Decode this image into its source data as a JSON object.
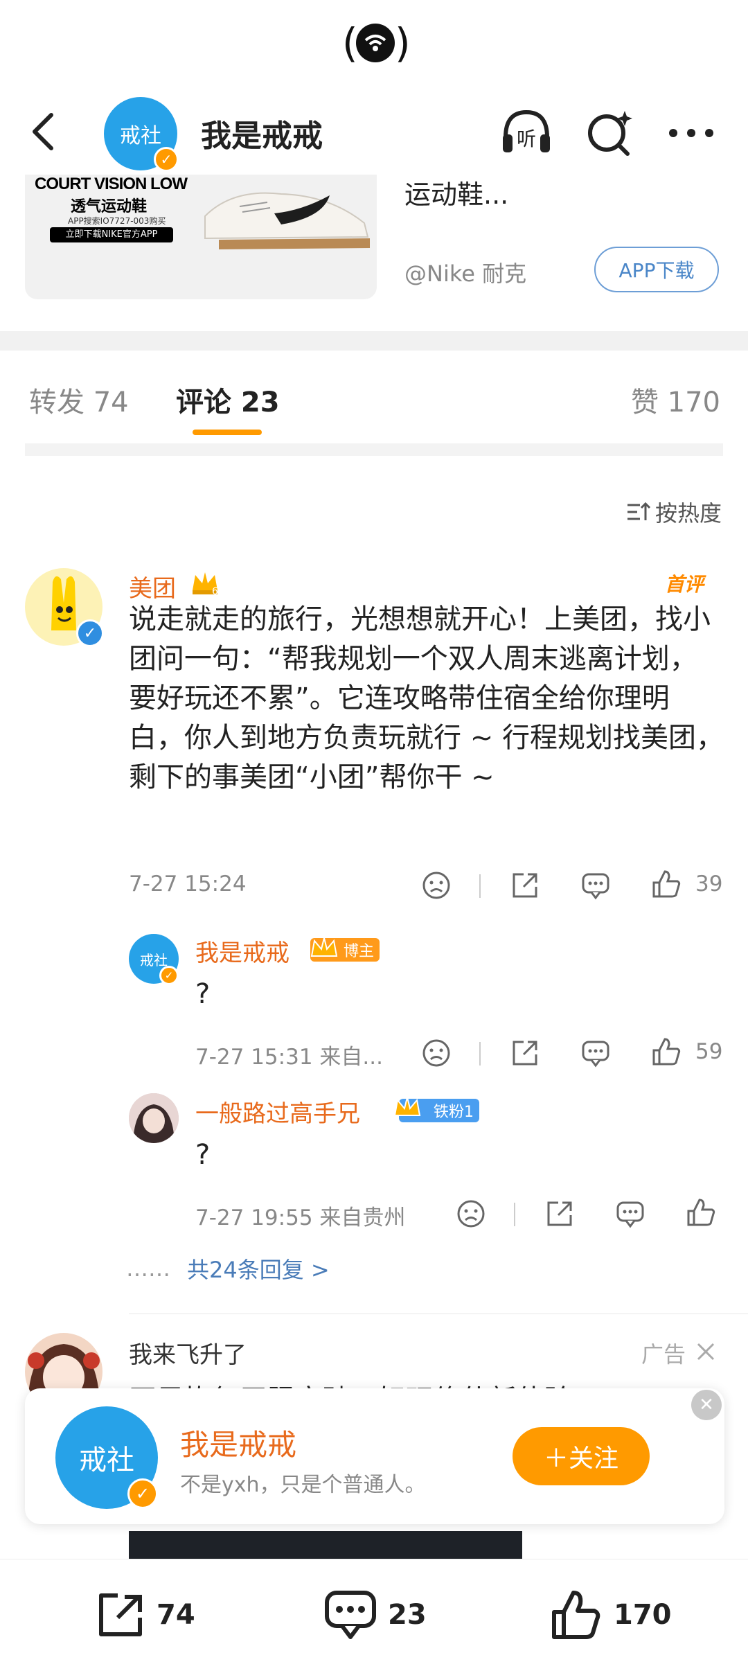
{
  "header": {
    "avatar_text": "戒社",
    "title": "我是戒戒",
    "listen_label": "听"
  },
  "ad": {
    "line1": "COURT VISION LOW",
    "line2": "透气运动鞋",
    "line3": "APP搜索IO7727-003购买",
    "line4": "立即下载NIKE官方APP",
    "title": "运动鞋...",
    "source": "@Nike 耐克",
    "download_label": "APP下载"
  },
  "tabs": {
    "repost": "转发 74",
    "comments": "评论 23",
    "likes": "赞 170"
  },
  "sort_label": "按热度",
  "main_comment": {
    "name": "美团",
    "top_label": "首评",
    "text": "说走就走的旅行，光想想就开心！上美团，找小团问一句：“帮我规划一个双人周末逃离计划，要好玩还不累”。它连攻略带住宿全给你理明白，你人到地方负责玩就行 ~ 行程规划找美团，剩下的事美团“小团”帮你干 ~",
    "time": "7-27 15:24",
    "likes": "39"
  },
  "replies": [
    {
      "avatar_text": "戒社",
      "name": "我是戒戒",
      "badge": "博主",
      "text": "?",
      "time": "7-27 15:31  来自...",
      "likes": "59"
    },
    {
      "name": "一般路过高手兄",
      "badge": "铁粉1",
      "text": "?",
      "time": "7-27 19:55  来自贵州",
      "likes": ""
    }
  ],
  "more_replies": {
    "dots": "……",
    "label": "共24条回复 >"
  },
  "next_comment": {
    "name": "我来飞升了",
    "ad_label": "广告",
    "partial_text": "开局恢复无限突破，好玩修仙新体验！"
  },
  "follow_card": {
    "avatar_text": "戒社",
    "name": "我是戒戒",
    "bio": "不是yxh，只是个普通人。",
    "follow_label": "＋关注"
  },
  "bottom_bar": {
    "repost": "74",
    "comments": "23",
    "likes": "170"
  },
  "colors": {
    "accent": "#ff9a00",
    "name_orange": "#e86a1c",
    "link_blue": "#4a7cb8",
    "avatar_blue": "#27a2e8"
  }
}
